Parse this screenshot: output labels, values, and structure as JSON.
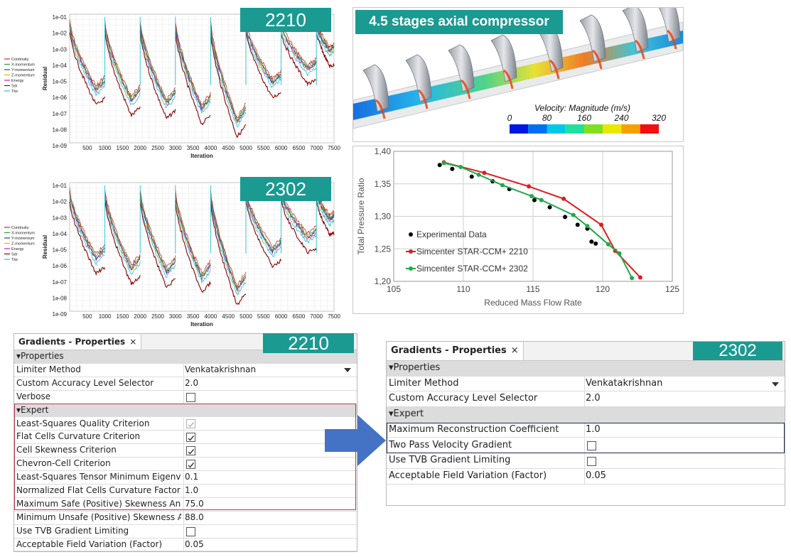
{
  "residual_charts": [
    {
      "badge": "2210",
      "ylabel": "Residual",
      "xlabel": "Iteration",
      "y_ticks": [
        "1e-01",
        "1e-02",
        "1e-03",
        "1e-04",
        "1e-05",
        "1e-06",
        "1e-07",
        "1e-08",
        "1e-09"
      ],
      "x_ticks": [
        "500",
        "1000",
        "1500",
        "2000",
        "2500",
        "3000",
        "3500",
        "4000",
        "4500",
        "5000",
        "5500",
        "6000",
        "6500",
        "7000",
        "7500"
      ],
      "legend": [
        {
          "name": "Continuity",
          "color": "#d62728"
        },
        {
          "name": "X-momentum",
          "color": "#2ca02c"
        },
        {
          "name": "Y-momentum",
          "color": "#1f3fbf"
        },
        {
          "name": "Z-momentum",
          "color": "#e6b400"
        },
        {
          "name": "Energy",
          "color": "#c020c0"
        },
        {
          "name": "Sdr",
          "color": "#8b0000"
        },
        {
          "name": "Tke",
          "color": "#20c0d0"
        }
      ]
    },
    {
      "badge": "2302",
      "ylabel": "Residual",
      "xlabel": "Iteration",
      "y_ticks": [
        "1e-01",
        "1e-02",
        "1e-03",
        "1e-04",
        "1e-05",
        "1e-06",
        "1e-07",
        "1e-08",
        "1e-09"
      ],
      "x_ticks": [
        "500",
        "1000",
        "1500",
        "2000",
        "2500",
        "3000",
        "3500",
        "4000",
        "4500",
        "5000",
        "5500",
        "6000",
        "6500",
        "7000",
        "7500"
      ],
      "legend": [
        {
          "name": "Continuity",
          "color": "#d62728"
        },
        {
          "name": "X-momentum",
          "color": "#2ca02c"
        },
        {
          "name": "Y-momentum",
          "color": "#1f3fbf"
        },
        {
          "name": "Z-momentum",
          "color": "#e6b400"
        },
        {
          "name": "Energy",
          "color": "#c020c0"
        },
        {
          "name": "Sdr",
          "color": "#8b0000"
        },
        {
          "name": "Tke",
          "color": "#20c0d0"
        }
      ]
    }
  ],
  "compressor": {
    "title": "4.5 stages axial compressor",
    "colorbar_label": "Velocity: Magnitude (m/s)",
    "colorbar_ticks": [
      "0",
      "80",
      "160",
      "240",
      "320"
    ],
    "colorbar_colors": [
      "#0018e0",
      "#0070f0",
      "#00c8e8",
      "#20e0a0",
      "#80e020",
      "#e8e800",
      "#f8a000",
      "#f01010"
    ]
  },
  "chart_data": {
    "type": "scatter",
    "xlabel": "Reduced Mass Flow Rate",
    "ylabel": "Total Pressure Ratio",
    "xlim": [
      105,
      125
    ],
    "ylim": [
      1.2,
      1.4
    ],
    "x_ticks": [
      "105",
      "110",
      "115",
      "120",
      "125"
    ],
    "y_ticks": [
      "1,20",
      "1,25",
      "1,30",
      "1,35",
      "1,40"
    ],
    "legend_position": "center-left",
    "series": [
      {
        "name": "Experimental Data",
        "color": "#000000",
        "style": "markers",
        "points": [
          [
            108.3,
            1.379
          ],
          [
            109.2,
            1.373
          ],
          [
            110.6,
            1.361
          ],
          [
            112.1,
            1.354
          ],
          [
            113.3,
            1.342
          ],
          [
            115.1,
            1.325
          ],
          [
            116.2,
            1.314
          ],
          [
            117.3,
            1.299
          ],
          [
            118.2,
            1.287
          ],
          [
            118.9,
            1.281
          ],
          [
            119.2,
            1.261
          ],
          [
            119.5,
            1.258
          ]
        ]
      },
      {
        "name": "Simcenter STAR-CCM+ 2210",
        "color": "#e41a1c",
        "style": "line-markers",
        "points": [
          [
            108.6,
            1.383
          ],
          [
            111.5,
            1.367
          ],
          [
            114.7,
            1.346
          ],
          [
            117.2,
            1.327
          ],
          [
            119.9,
            1.287
          ],
          [
            120.9,
            1.247
          ],
          [
            122.7,
            1.206
          ]
        ]
      },
      {
        "name": "Simcenter STAR-CCM+ 2302",
        "color": "#1faa4a",
        "style": "line-markers",
        "points": [
          [
            108.6,
            1.382
          ],
          [
            109.8,
            1.376
          ],
          [
            111.1,
            1.364
          ],
          [
            112.8,
            1.348
          ],
          [
            114.9,
            1.331
          ],
          [
            115.6,
            1.325
          ],
          [
            117.9,
            1.302
          ],
          [
            118.9,
            1.285
          ],
          [
            120.4,
            1.257
          ],
          [
            121.2,
            1.243
          ],
          [
            122.1,
            1.205
          ]
        ]
      }
    ]
  },
  "panel_2210": {
    "badge": "2210",
    "tab_label": "Gradients - Properties",
    "close": "×",
    "rows": [
      {
        "type": "section",
        "label": "Properties"
      },
      {
        "type": "value",
        "label": "Limiter Method",
        "value": "Venkatakrishnan",
        "dropdown": true
      },
      {
        "type": "value",
        "label": "Custom Accuracy Level Selector",
        "value": "2.0"
      },
      {
        "type": "check",
        "label": "Verbose",
        "checked": false
      },
      {
        "type": "section",
        "label": "Expert"
      },
      {
        "type": "check",
        "label": "Least-Squares Quality Criterion",
        "checked": true,
        "disabled": true
      },
      {
        "type": "check",
        "label": "Flat Cells Curvature Criterion",
        "checked": true
      },
      {
        "type": "check",
        "label": "Cell Skewness Criterion",
        "checked": true
      },
      {
        "type": "check",
        "label": "Chevron-Cell Criterion",
        "checked": true
      },
      {
        "type": "value",
        "label": "Least-Squares Tensor Minimum Eigenvalue",
        "value": "0.1"
      },
      {
        "type": "value",
        "label": "Normalized Flat Cells Curvature Factor",
        "value": "1.0"
      },
      {
        "type": "value",
        "label": "Maximum Safe (Positive) Skewness Angle",
        "value": "75.0"
      },
      {
        "type": "value",
        "label": "Minimum Unsafe (Positive) Skewness Angle",
        "value": "88.0"
      },
      {
        "type": "check",
        "label": "Use TVB Gradient Limiting",
        "checked": false
      },
      {
        "type": "value",
        "label": "Acceptable Field Variation (Factor)",
        "value": "0.05"
      }
    ]
  },
  "panel_2302": {
    "badge": "2302",
    "tab_label": "Gradients - Properties",
    "close": "×",
    "rows": [
      {
        "type": "section",
        "label": "Properties"
      },
      {
        "type": "value",
        "label": "Limiter Method",
        "value": "Venkatakrishnan",
        "dropdown": true
      },
      {
        "type": "value",
        "label": "Custom Accuracy Level Selector",
        "value": "2.0"
      },
      {
        "type": "section",
        "label": "Expert"
      },
      {
        "type": "value",
        "label": "Maximum Reconstruction Coefficient",
        "value": "1.0"
      },
      {
        "type": "check",
        "label": "Two Pass Velocity Gradient",
        "checked": false
      },
      {
        "type": "check",
        "label": "Use TVB Gradient Limiting",
        "checked": false
      },
      {
        "type": "value",
        "label": "Acceptable Field Variation (Factor)",
        "value": "0.05"
      }
    ]
  },
  "colors": {
    "badge": "#1a9a91",
    "arrow": "#4472c4",
    "highlight_2210": "#c0394b",
    "highlight_2302": "#1f2a44"
  }
}
